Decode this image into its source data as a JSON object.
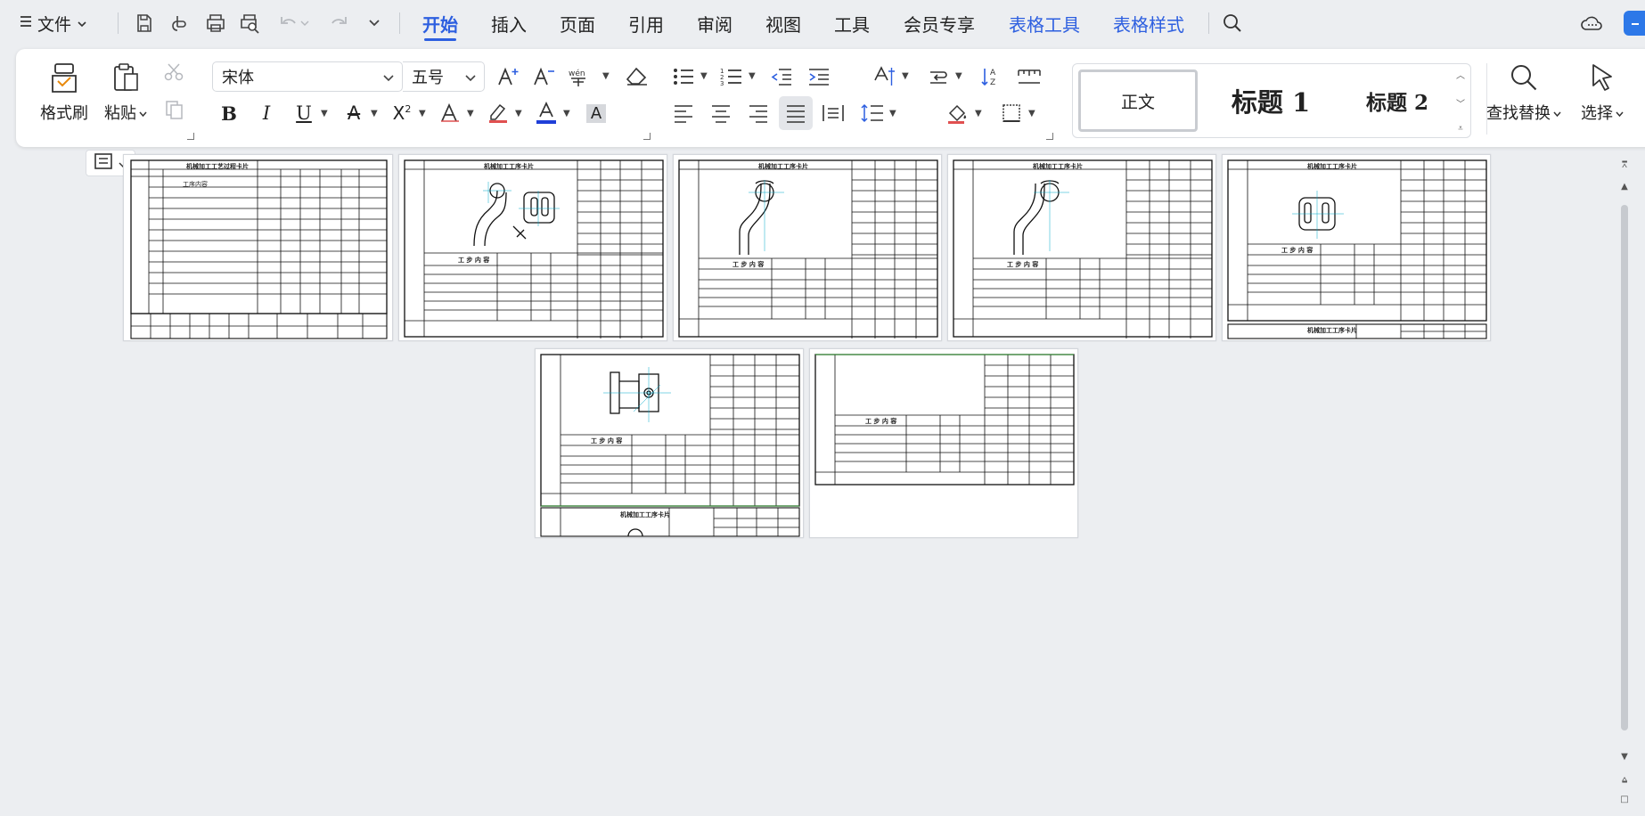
{
  "menubar": {
    "file_label": "文件",
    "tabs": [
      {
        "label": "开始",
        "state": "active"
      },
      {
        "label": "插入",
        "state": ""
      },
      {
        "label": "页面",
        "state": ""
      },
      {
        "label": "引用",
        "state": ""
      },
      {
        "label": "审阅",
        "state": ""
      },
      {
        "label": "视图",
        "state": ""
      },
      {
        "label": "工具",
        "state": ""
      },
      {
        "label": "会员专享",
        "state": ""
      },
      {
        "label": "表格工具",
        "state": "contextual"
      },
      {
        "label": "表格样式",
        "state": "contextual"
      }
    ]
  },
  "ribbon": {
    "format_painter_label": "格式刷",
    "paste_label": "粘贴",
    "font_name": "宋体",
    "font_size": "五号",
    "styles": {
      "normal": "正文",
      "heading1": "标题 1",
      "heading2": "标题 2"
    },
    "find_replace_label": "查找替换",
    "select_label": "选择"
  },
  "document": {
    "thumbnail_caption": "机械加工工序卡片",
    "process_table_caption": "工 步 内 容",
    "cover_caption": "机械加工工艺过程卡片",
    "process_content_label": "工序内容"
  },
  "colors": {
    "accent": "#2d5fe0",
    "font_color_bar": "#1f3fd8",
    "highlight_bar": "#e05050"
  }
}
